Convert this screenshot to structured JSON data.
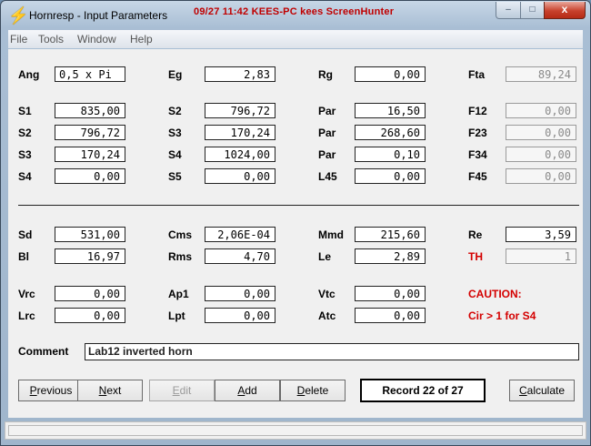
{
  "window": {
    "title": "Hornresp - Input Parameters",
    "overlay": "09/27  11:42  KEES-PC  kees  ScreenHunter",
    "minimize": "–",
    "maximize": "□",
    "close": "x"
  },
  "menu": {
    "file": "File",
    "tools": "Tools",
    "window": "Window",
    "help": "Help"
  },
  "params": {
    "ang": {
      "label": "Ang",
      "value": "0,5 x Pi"
    },
    "eg": {
      "label": "Eg",
      "value": "2,83"
    },
    "rg": {
      "label": "Rg",
      "value": "0,00"
    },
    "fta": {
      "label": "Fta",
      "value": "89,24"
    },
    "s1": {
      "label": "S1",
      "value": "835,00"
    },
    "s2b": {
      "label": "S2",
      "value": "796,72"
    },
    "par1": {
      "label": "Par",
      "value": "16,50"
    },
    "f12": {
      "label": "F12",
      "value": "0,00"
    },
    "s2": {
      "label": "S2",
      "value": "796,72"
    },
    "s3b": {
      "label": "S3",
      "value": "170,24"
    },
    "par2": {
      "label": "Par",
      "value": "268,60"
    },
    "f23": {
      "label": "F23",
      "value": "0,00"
    },
    "s3": {
      "label": "S3",
      "value": "170,24"
    },
    "s4b": {
      "label": "S4",
      "value": "1024,00"
    },
    "par3": {
      "label": "Par",
      "value": "0,10"
    },
    "f34": {
      "label": "F34",
      "value": "0,00"
    },
    "s4": {
      "label": "S4",
      "value": "0,00"
    },
    "s5": {
      "label": "S5",
      "value": "0,00"
    },
    "l45": {
      "label": "L45",
      "value": "0,00"
    },
    "f45": {
      "label": "F45",
      "value": "0,00"
    },
    "sd": {
      "label": "Sd",
      "value": "531,00"
    },
    "cms": {
      "label": "Cms",
      "value": "2,06E-04"
    },
    "mmd": {
      "label": "Mmd",
      "value": "215,60"
    },
    "re": {
      "label": "Re",
      "value": "3,59"
    },
    "bl": {
      "label": "Bl",
      "value": "16,97"
    },
    "rms": {
      "label": "Rms",
      "value": "4,70"
    },
    "le": {
      "label": "Le",
      "value": "2,89"
    },
    "th": {
      "label": "TH",
      "value": "1"
    },
    "vrc": {
      "label": "Vrc",
      "value": "0,00"
    },
    "ap1": {
      "label": "Ap1",
      "value": "0,00"
    },
    "vtc": {
      "label": "Vtc",
      "value": "0,00"
    },
    "lrc": {
      "label": "Lrc",
      "value": "0,00"
    },
    "lpt": {
      "label": "Lpt",
      "value": "0,00"
    },
    "atc": {
      "label": "Atc",
      "value": "0,00"
    }
  },
  "caution": {
    "title": "CAUTION:",
    "message": "Cir > 1 for S4"
  },
  "comment": {
    "label": "Comment",
    "value": "Lab12 inverted horn"
  },
  "buttons": {
    "previous": "Previous",
    "next": "Next",
    "edit": "Edit",
    "add": "Add",
    "delete": "Delete",
    "calculate": "Calculate"
  },
  "record": "Record 22 of 27",
  "colors": {
    "warning": "#d40000",
    "close_button": "#c8412c",
    "overlay_text": "#c00000"
  }
}
